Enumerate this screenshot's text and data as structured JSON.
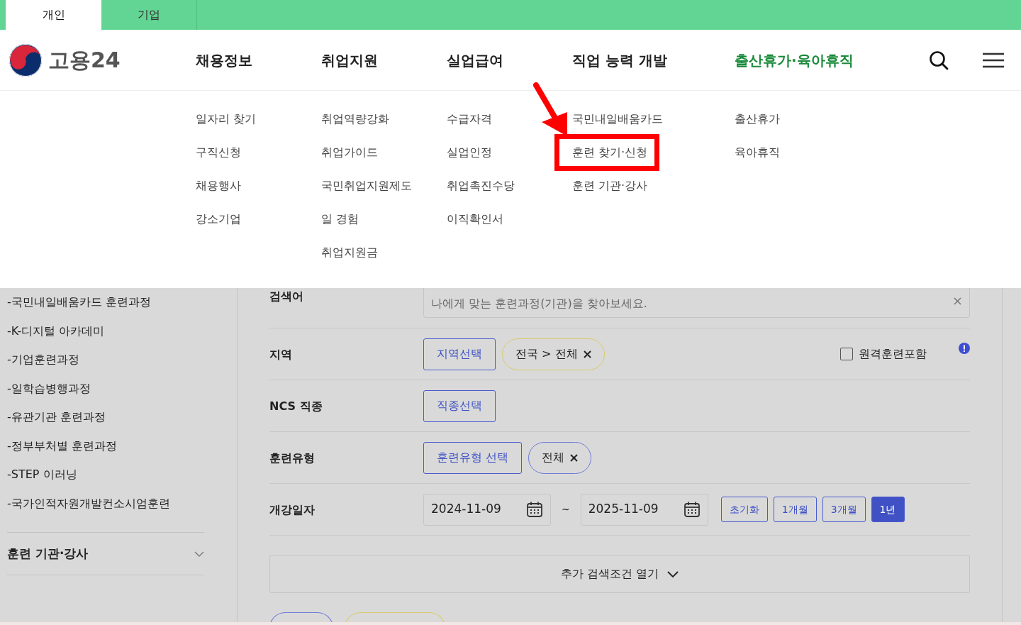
{
  "top_tabs": [
    {
      "label": "개인",
      "selected": true
    },
    {
      "label": "기업",
      "selected": false
    }
  ],
  "logo": {
    "text": "고용24"
  },
  "nav": [
    {
      "label": "채용정보",
      "selected": false,
      "submenu": [
        {
          "label": "일자리 찾기",
          "annotated": false
        },
        {
          "label": "구직신청",
          "annotated": false
        },
        {
          "label": "채용행사",
          "annotated": false
        },
        {
          "label": "강소기업",
          "annotated": false
        }
      ]
    },
    {
      "label": "취업지원",
      "selected": false,
      "submenu": [
        {
          "label": "취업역량강화",
          "annotated": false
        },
        {
          "label": "취업가이드",
          "annotated": false
        },
        {
          "label": "국민취업지원제도",
          "annotated": false
        },
        {
          "label": "일 경험",
          "annotated": false
        },
        {
          "label": "취업지원금",
          "annotated": false
        }
      ]
    },
    {
      "label": "실업급여",
      "selected": false,
      "submenu": [
        {
          "label": "수급자격",
          "annotated": false
        },
        {
          "label": "실업인정",
          "annotated": false
        },
        {
          "label": "취업촉진수당",
          "annotated": false
        },
        {
          "label": "이직확인서",
          "annotated": false
        }
      ]
    },
    {
      "label": "직업 능력 개발",
      "selected": false,
      "submenu": [
        {
          "label": "국민내일배움카드",
          "annotated": false
        },
        {
          "label": "훈련 찾기·신청",
          "annotated": true
        },
        {
          "label": "훈련 기관·강사",
          "annotated": false
        }
      ]
    },
    {
      "label": "출산휴가·육아휴직",
      "selected": true,
      "submenu": [
        {
          "label": "출산휴가",
          "annotated": false
        },
        {
          "label": "육아휴직",
          "annotated": false
        }
      ]
    }
  ],
  "sidebar": {
    "items": [
      {
        "label": "-국민내일배움카드 훈련과정"
      },
      {
        "label": "-K-디지털 아카데미"
      },
      {
        "label": "-기업훈련과정"
      },
      {
        "label": "-일학습병행과정"
      },
      {
        "label": "-유관기관 훈련과정"
      },
      {
        "label": "-정부부처별 훈련과정"
      },
      {
        "label": "-STEP 이러닝"
      },
      {
        "label": "-국가인적자원개발컨소시엄훈련"
      }
    ],
    "sections": [
      {
        "label": "훈련 기관·강사",
        "expanded": false
      }
    ]
  },
  "search_form": {
    "keyword": {
      "label": "검색어",
      "placeholder": "나에게 맞는 훈련과정(기관)을 찾아보세요."
    },
    "region": {
      "label": "지역",
      "button": "지역선택",
      "chips": [
        {
          "label": "전국 > 전체",
          "color": "#d8cc6a"
        }
      ],
      "remote": {
        "label": "원격훈련포함",
        "checked": false
      }
    },
    "ncs": {
      "label": "NCS 직종",
      "button": "직종선택"
    },
    "training_type": {
      "label": "훈련유형",
      "button": "훈련유형 선택",
      "chips": [
        {
          "label": "전체",
          "color": "#6f7bd6"
        }
      ]
    },
    "start_date": {
      "label": "개강일자",
      "from": "2024-11-09",
      "separator": "~",
      "to": "2025-11-09",
      "periods": [
        {
          "label": "초기화",
          "selected": false
        },
        {
          "label": "1개월",
          "selected": false
        },
        {
          "label": "3개월",
          "selected": false
        },
        {
          "label": "1년",
          "selected": true
        }
      ]
    },
    "more_button": "추가 검색조건 열기"
  },
  "result_chips": [
    {
      "color": "#6f7bd6"
    },
    {
      "color": "#d8cc6a"
    }
  ]
}
